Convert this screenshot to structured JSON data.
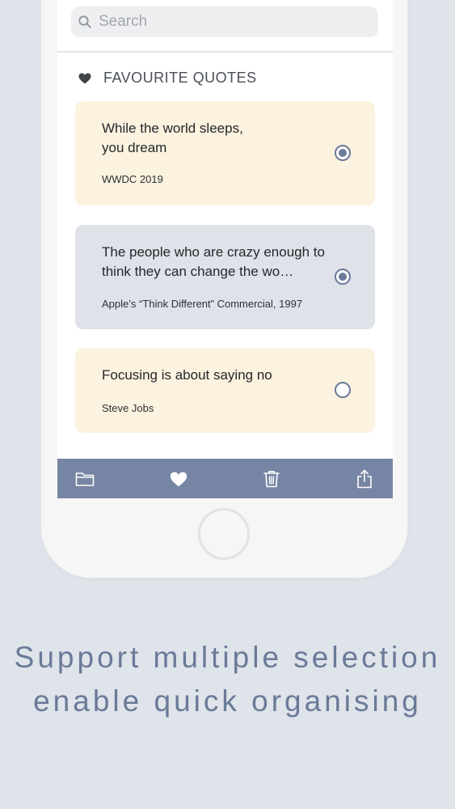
{
  "search": {
    "placeholder": "Search",
    "icon": "search-icon"
  },
  "section": {
    "title": "FAVOURITE QUOTES",
    "icon": "heart-icon"
  },
  "quotes": [
    {
      "text": "While the world sleeps, you dream",
      "author": "WWDC 2019",
      "selected": true
    },
    {
      "text": "The people who are crazy enough to think they can change the wo…",
      "author": "Apple’s “Think Different” Commercial, 1997",
      "selected": true
    },
    {
      "text": "Focusing is about saying no",
      "author": "Steve Jobs",
      "selected": false
    }
  ],
  "toolbar": {
    "items": [
      {
        "icon": "folder-icon"
      },
      {
        "icon": "heart-icon"
      },
      {
        "icon": "trash-icon"
      },
      {
        "icon": "share-icon"
      }
    ]
  },
  "colors": {
    "background": "#dfe3ea",
    "accent": "#7685a3",
    "card_cream": "#fbf2df",
    "card_selected": "#dfe2e9",
    "caption_text": "#6a7a98"
  },
  "caption": {
    "line1": "Support multiple selection",
    "line2": "enable quick organising"
  }
}
